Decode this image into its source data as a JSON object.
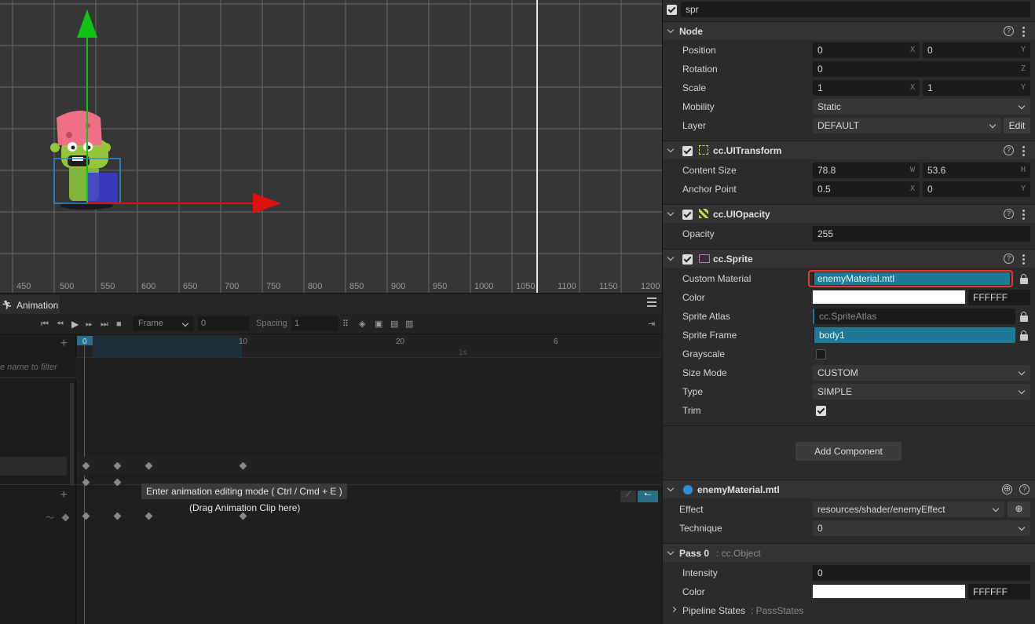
{
  "scene": {
    "ruler_labels": [
      "450",
      "500",
      "550",
      "600",
      "650",
      "700",
      "750",
      "800",
      "850",
      "900",
      "950",
      "1000",
      "1050",
      "1100",
      "1150",
      "1200"
    ]
  },
  "animation": {
    "tab_label": "Animation",
    "mode_select": "Frame",
    "frame_value": "0",
    "spacing_label": "Spacing",
    "spacing_value": "1",
    "timeline_ticks": [
      "0",
      "10",
      "20",
      "6"
    ],
    "time_marker": "1s",
    "filter_placeholder": "e name to filter",
    "tooltip": "Enter animation editing mode ( Ctrl / Cmd + E )",
    "drag_hint": "(Drag Animation Clip here)"
  },
  "inspector": {
    "node_name": "spr",
    "node": {
      "title": "Node",
      "position_label": "Position",
      "position_x": "0",
      "position_y": "0",
      "rotation_label": "Rotation",
      "rotation_z": "0",
      "scale_label": "Scale",
      "scale_x": "1",
      "scale_y": "1",
      "mobility_label": "Mobility",
      "mobility_value": "Static",
      "layer_label": "Layer",
      "layer_value": "DEFAULT",
      "edit_label": "Edit"
    },
    "ui_transform": {
      "title": "cc.UITransform",
      "content_size_label": "Content Size",
      "width": "78.8",
      "height": "53.6",
      "anchor_label": "Anchor Point",
      "anchor_x": "0.5",
      "anchor_y": "0"
    },
    "ui_opacity": {
      "title": "cc.UIOpacity",
      "opacity_label": "Opacity",
      "opacity_value": "255"
    },
    "sprite": {
      "title": "cc.Sprite",
      "custom_material_label": "Custom Material",
      "custom_material_value": "enemyMaterial.mtl",
      "color_label": "Color",
      "color_hex": "FFFFFF",
      "sprite_atlas_label": "Sprite Atlas",
      "sprite_atlas_value": "cc.SpriteAtlas",
      "sprite_frame_label": "Sprite Frame",
      "sprite_frame_value": "body1",
      "grayscale_label": "Grayscale",
      "size_mode_label": "Size Mode",
      "size_mode_value": "CUSTOM",
      "type_label": "Type",
      "type_value": "SIMPLE",
      "trim_label": "Trim"
    },
    "add_component_label": "Add Component",
    "material": {
      "title": "enemyMaterial.mtl",
      "effect_label": "Effect",
      "effect_value": "resources/shader/enemyEffect",
      "technique_label": "Technique",
      "technique_value": "0"
    },
    "pass": {
      "title": "Pass 0",
      "type": ": cc.Object",
      "intensity_label": "Intensity",
      "intensity_value": "0",
      "color_label": "Color",
      "color_hex": "FFFFFF",
      "pipeline_label": "Pipeline States",
      "pipeline_type": ": PassStates"
    },
    "axes": {
      "x": "X",
      "y": "Y",
      "z": "Z",
      "w": "W",
      "h": "H"
    }
  },
  "colors": {
    "asset_highlight": "#1e7a96",
    "selection_outline": "#e53935",
    "gizmo_x": "#e01010",
    "gizmo_y": "#11c411",
    "playhead": "#2a6f8a"
  }
}
